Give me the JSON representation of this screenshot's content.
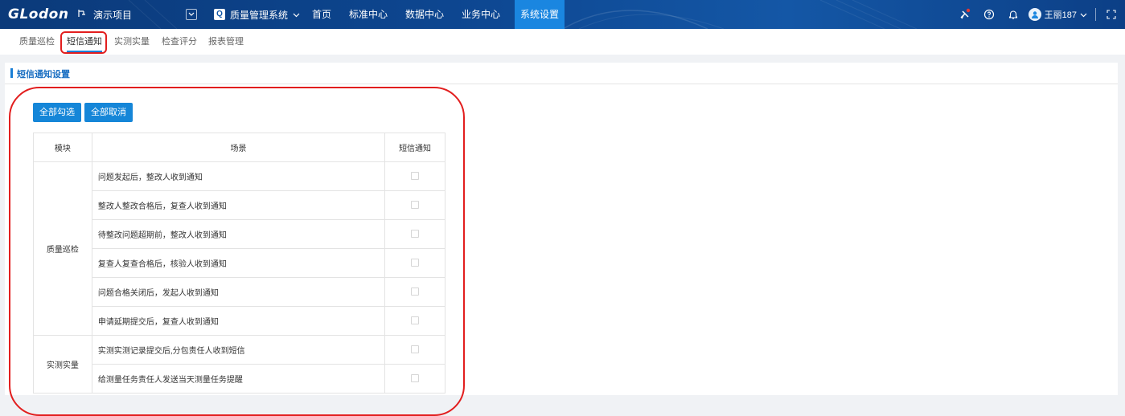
{
  "topbar": {
    "logo": "GLodon",
    "project_icon": "project-switch-icon",
    "project_name": "演示项目",
    "system_name": "质量管理系统",
    "nav": [
      {
        "label": "首页",
        "active": false
      },
      {
        "label": "标准中心",
        "active": false
      },
      {
        "label": "数据中心",
        "active": false
      },
      {
        "label": "业务中心",
        "active": false
      },
      {
        "label": "系统设置",
        "active": true
      }
    ],
    "user_name": "王丽187",
    "colors": {
      "bar": "#0d4690",
      "active_nav": "#1a86e0",
      "notify_dot": "#e53935"
    }
  },
  "subtabs": [
    {
      "label": "质量巡检",
      "active": false
    },
    {
      "label": "短信通知",
      "active": true
    },
    {
      "label": "实测实量",
      "active": false
    },
    {
      "label": "检查评分",
      "active": false
    },
    {
      "label": "报表管理",
      "active": false
    }
  ],
  "panel": {
    "title": "短信通知设置",
    "select_all": "全部勾选",
    "cancel_all": "全部取消",
    "columns": {
      "module": "模块",
      "scene": "场景",
      "sms": "短信通知"
    },
    "groups": [
      {
        "module": "质量巡检",
        "rows": [
          {
            "scene": "问题发起后，整改人收到通知",
            "checked": false
          },
          {
            "scene": "整改人整改合格后，复查人收到通知",
            "checked": false
          },
          {
            "scene": "待整改问题超期前，整改人收到通知",
            "checked": false
          },
          {
            "scene": "复查人复查合格后，核验人收到通知",
            "checked": false
          },
          {
            "scene": "问题合格关闭后，发起人收到通知",
            "checked": false
          },
          {
            "scene": "申请延期提交后，复查人收到通知",
            "checked": false
          }
        ]
      },
      {
        "module": "实测实量",
        "rows": [
          {
            "scene": "实测实测记录提交后,分包责任人收到短信",
            "checked": false
          },
          {
            "scene": "给测量任务责任人发送当天测量任务提醒",
            "checked": false
          }
        ]
      }
    ]
  },
  "accent": "#1586d8",
  "highlight": "#e21e1e"
}
